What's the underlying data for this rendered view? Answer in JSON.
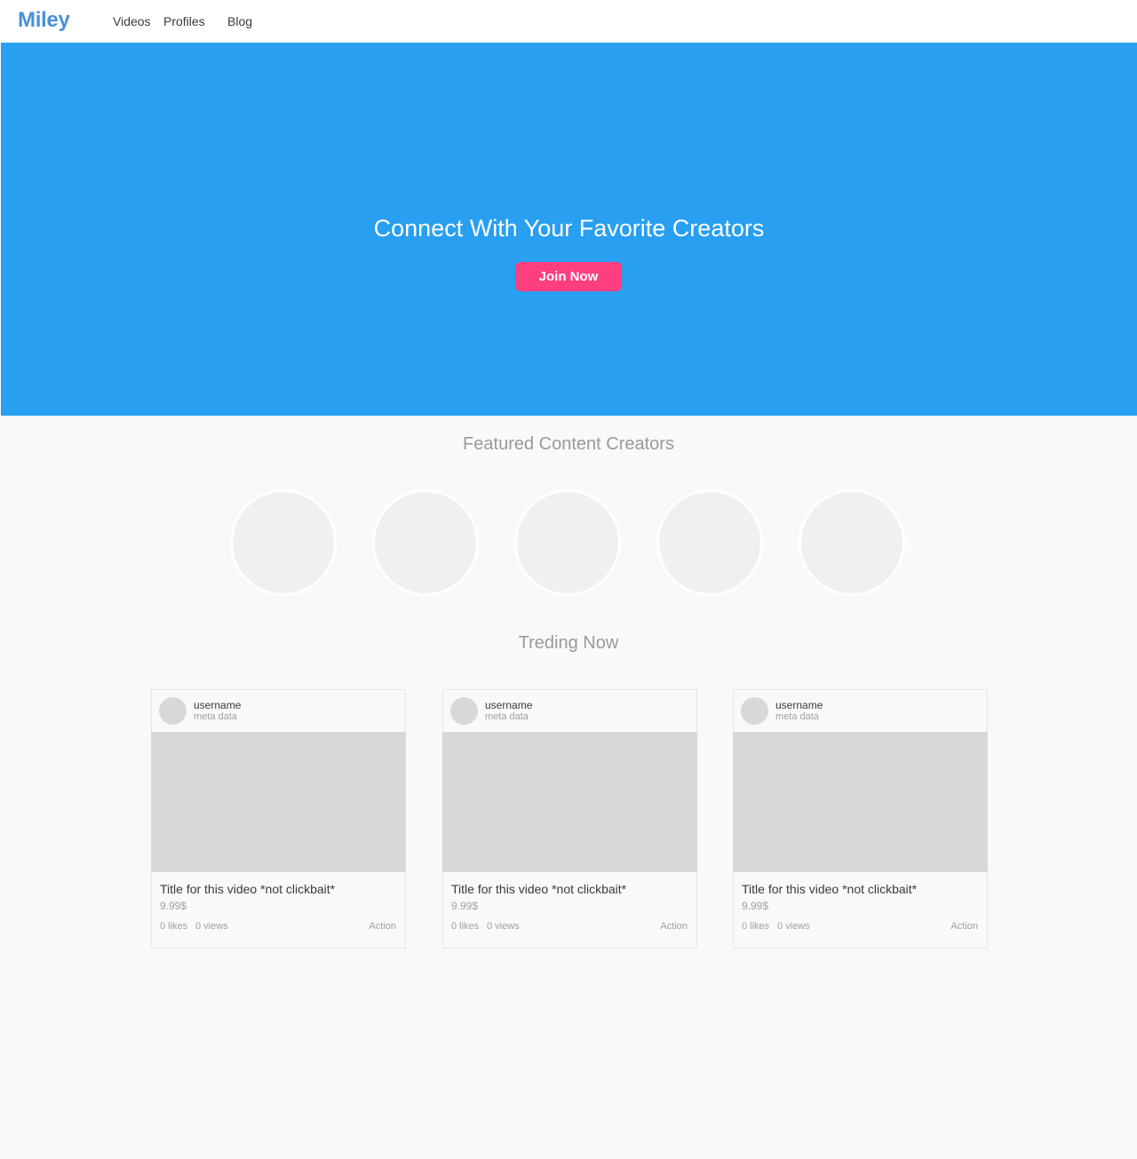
{
  "header": {
    "logo": "Miley",
    "nav": [
      "Videos",
      "Profiles",
      "Blog"
    ]
  },
  "hero": {
    "title": "Connect With Your Favorite Creators",
    "cta_label": "Join Now"
  },
  "featured": {
    "title": "Featured Content Creators",
    "creator_count": 5
  },
  "trending": {
    "title": "Treding Now",
    "cards": [
      {
        "username": "username",
        "meta": "meta data",
        "title": "Title for this video *not clickbait*",
        "price": "9.99$",
        "likes": "0 likes",
        "views": "0 views",
        "action": "Action"
      },
      {
        "username": "username",
        "meta": "meta data",
        "title": "Title for this video *not clickbait*",
        "price": "9.99$",
        "likes": "0 likes",
        "views": "0 views",
        "action": "Action"
      },
      {
        "username": "username",
        "meta": "meta data",
        "title": "Title for this video *not clickbait*",
        "price": "9.99$",
        "likes": "0 likes",
        "views": "0 views",
        "action": "Action"
      }
    ]
  },
  "colors": {
    "brand": "#4a90d9",
    "hero_bg": "#289ff0",
    "cta": "#fd3f7f"
  }
}
